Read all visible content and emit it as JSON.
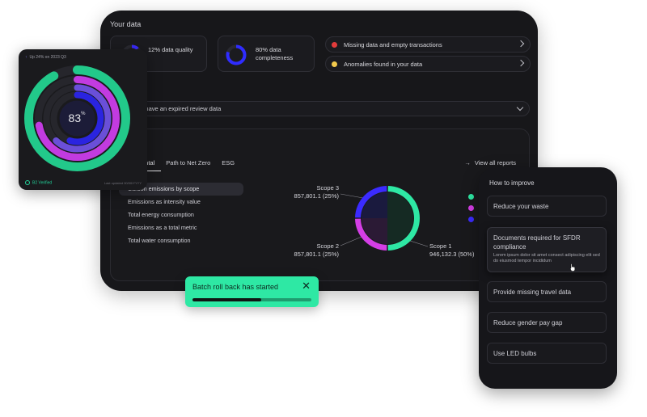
{
  "dashboard": {
    "title": "Your data",
    "stats": [
      {
        "label": "12% data quality",
        "value": 0.12,
        "color": "#3b2bff"
      },
      {
        "label": "80% data completeness",
        "value": 0.8,
        "color": "#2f2cff"
      }
    ],
    "issues": [
      {
        "label": "Missing data and empty transactions",
        "color": "#e23b3b"
      },
      {
        "label": "Anomalies found in your data",
        "color": "#f2c94c"
      }
    ],
    "review": {
      "label": "nents have an expired review data"
    },
    "report": {
      "heading": "g",
      "tabs": [
        "ental",
        "Path to Net Zero",
        "ESG"
      ],
      "view_all": "View all reports",
      "metrics": [
        "Carbon emissions by scope",
        "Emissions as intensity value",
        "Total energy consumption",
        "Emissions as a total metric",
        "Total water consumption"
      ]
    }
  },
  "chart_data": {
    "type": "pie",
    "categories": [
      "Scope 1",
      "Scope 2",
      "Scope 3"
    ],
    "values": [
      946132.3,
      857801.1,
      857801.1
    ],
    "labels": [
      {
        "name": "Scope 1",
        "value": "946,132.3 (50%)"
      },
      {
        "name": "Scope 2",
        "value": "857,801.1 (25%)"
      },
      {
        "name": "Scope 3",
        "value": "857,801.1 (25%)"
      }
    ],
    "percent": [
      50,
      25,
      25
    ],
    "colors": [
      "#2ee8a4",
      "#d43ee6",
      "#3b2bff"
    ]
  },
  "score": {
    "header": "Up 24% on 2023 Q3",
    "value": "83",
    "suffix": "%",
    "verified": "B2 Verified",
    "updated": "Last updated 00/00/YYYY",
    "rings": [
      {
        "value": 0.92,
        "color": "#22c98a"
      },
      {
        "value": 0.72,
        "color": "#c23be0"
      },
      {
        "value": 0.62,
        "color": "#6a4fd8"
      },
      {
        "value": 0.55,
        "color": "#2a24e0"
      }
    ]
  },
  "improve": {
    "title": "How to improve",
    "items": [
      {
        "label": "Reduce your waste"
      },
      {
        "label": "Documents required for SFDR compliance",
        "desc": "Lorem ipsum dolor sit amet consect adipiscing elit sed do eiusmod tempor incididum"
      },
      {
        "label": "Provide missing travel data"
      },
      {
        "label": "Reduce gender pay gap"
      },
      {
        "label": "Use LED bulbs"
      }
    ]
  },
  "toast": {
    "message": "Batch roll back has started",
    "close": "✕",
    "progress": 0.58
  }
}
